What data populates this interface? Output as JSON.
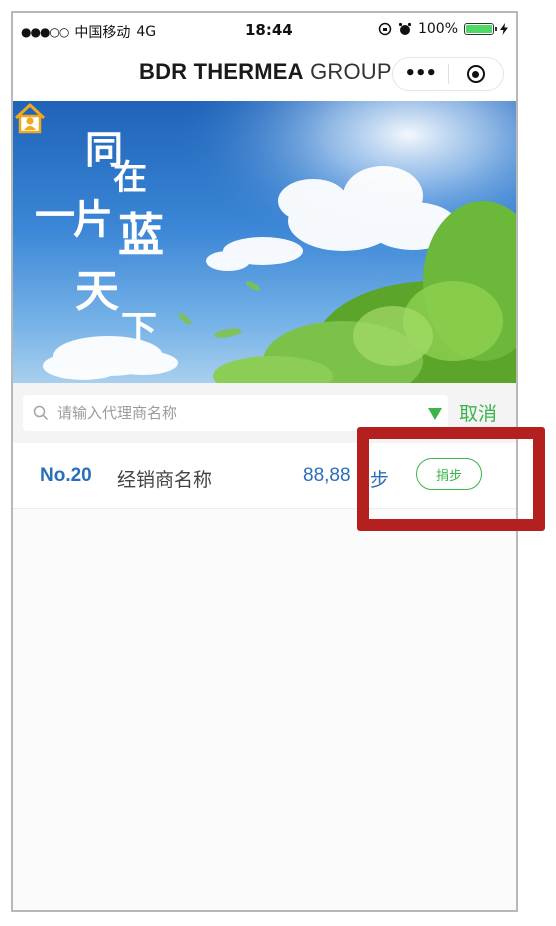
{
  "status_bar": {
    "signal": "●●●○○",
    "carrier": "中国移动",
    "network": "4G",
    "time": "18:44",
    "battery": "100%"
  },
  "title_bar": {
    "brand_bold": "BDR THERMEA",
    "brand_light": "GROUP",
    "more_label": "•••"
  },
  "banner": {
    "calligraphy": [
      "同",
      "在",
      "一",
      "片",
      "蓝",
      "天",
      "下"
    ]
  },
  "search": {
    "placeholder": "请输入代理商名称",
    "value": "",
    "cancel_label": "取消"
  },
  "list": [
    {
      "rank": "No.20",
      "name": "经销商名称",
      "steps": "88,88",
      "unit": "步",
      "action": "捐步"
    }
  ],
  "colors": {
    "accent_green": "#3cb44b",
    "rank_blue": "#2a6ebb",
    "highlight_red": "#b4201f"
  }
}
